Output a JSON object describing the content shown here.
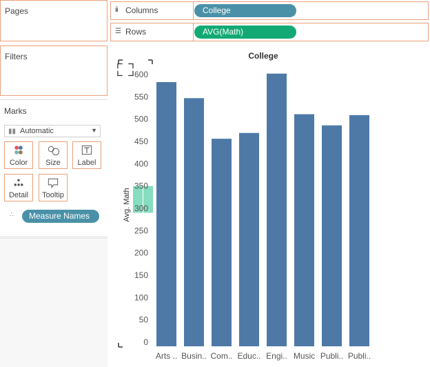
{
  "left_panel": {
    "pages_title": "Pages",
    "filters_title": "Filters",
    "marks_title": "Marks",
    "mark_type": "Automatic",
    "mark_buttons": {
      "color": "Color",
      "size": "Size",
      "label": "Label",
      "detail": "Detail",
      "tooltip": "Tooltip"
    },
    "measure_pill": "Measure Names"
  },
  "shelves": {
    "columns_label": "Columns",
    "columns_pill": "College",
    "rows_label": "Rows",
    "rows_pill": "AVG(Math)"
  },
  "colors": {
    "bar": "#4e79a7",
    "dimension_pill": "#4a91a8",
    "measure_pill": "#13a974",
    "shelf_border": "#e8a079",
    "drag_highlight": "#5dd2a9"
  },
  "chart_data": {
    "type": "bar",
    "header": "College",
    "ylabel": "Avg. Math",
    "xlabel": "",
    "categories": [
      "Arts ..",
      "Busin..",
      "Com..",
      "Educ..",
      "Engi..",
      "Music",
      "Publi..",
      "Publi.."
    ],
    "values": [
      583,
      547,
      456,
      469,
      602,
      511,
      486,
      509
    ],
    "ylim": [
      0,
      600
    ],
    "yticks": [
      0,
      50,
      100,
      150,
      200,
      250,
      300,
      350,
      400,
      450,
      500,
      550,
      600
    ],
    "grid": false,
    "drag_highlight_range": [
      290,
      350
    ]
  }
}
